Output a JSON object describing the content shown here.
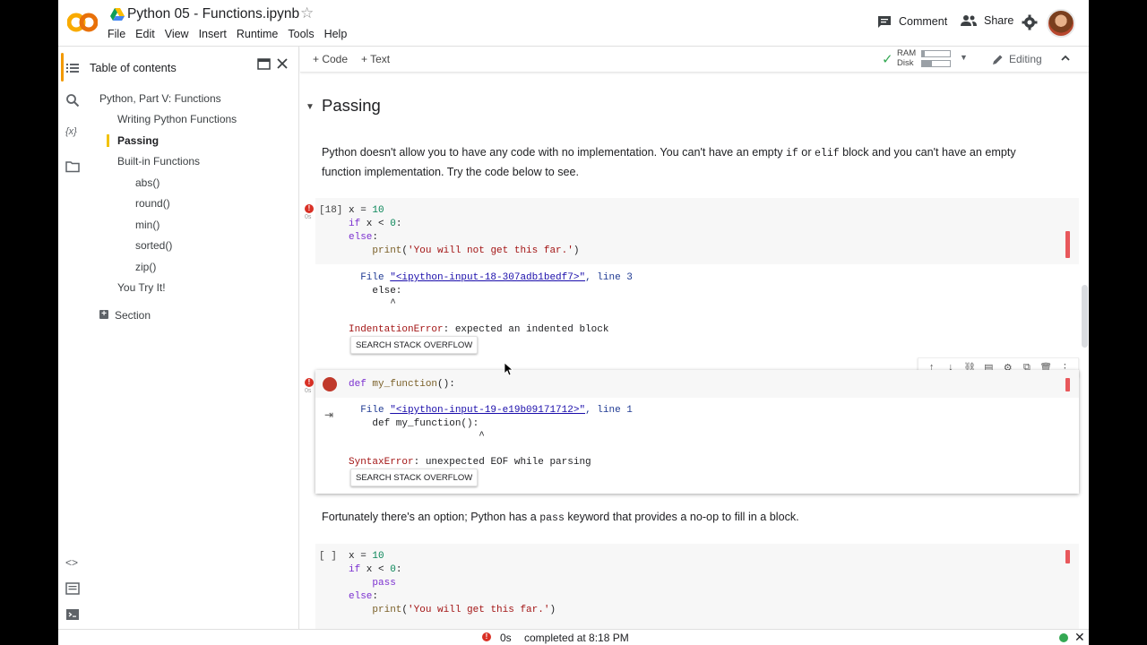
{
  "header": {
    "title": "Python 05 - Functions.ipynb",
    "menu": [
      "File",
      "Edit",
      "View",
      "Insert",
      "Runtime",
      "Tools",
      "Help"
    ],
    "comment_label": "Comment",
    "share_label": "Share"
  },
  "toc": {
    "title": "Table of contents",
    "items": [
      {
        "label": "Python, Part V: Functions",
        "level": 1
      },
      {
        "label": "Writing Python Functions",
        "level": 2
      },
      {
        "label": "Passing",
        "level": 2,
        "current": true
      },
      {
        "label": "Built-in Functions",
        "level": 2
      },
      {
        "label": "abs()",
        "level": 3
      },
      {
        "label": "round()",
        "level": 3
      },
      {
        "label": "min()",
        "level": 3
      },
      {
        "label": "sorted()",
        "level": 3
      },
      {
        "label": "zip()",
        "level": 3
      },
      {
        "label": "You Try It!",
        "level": 2
      }
    ],
    "section_label": "Section"
  },
  "toolbar": {
    "add_code": "+ Code",
    "add_text": "+ Text",
    "ram_label": "RAM",
    "disk_label": "Disk",
    "ram_fraction": 0.1,
    "disk_fraction": 0.35,
    "editing_label": "Editing"
  },
  "notebook": {
    "section_heading": "Passing",
    "intro_before_if": "Python doesn't allow you to have any code with no implementation. You can't have an empty ",
    "intro_code_if": "if",
    "intro_between": " or ",
    "intro_code_elif": "elif",
    "intro_after": " block and you can't have an empty function implementation. Try the code below to see.",
    "cell1": {
      "exec_count": "[18]",
      "time": "0s",
      "output_file_prefix": "  File ",
      "output_file_link": "\"<ipython-input-18-307adb1bedf7>\"",
      "output_file_suffix": ", line 3",
      "output_line2": "    else:",
      "output_line3": "       ^",
      "error_type": "IndentationError",
      "error_msg": ": expected an indented block",
      "so_button": "SEARCH STACK OVERFLOW"
    },
    "cell2": {
      "time": "0s",
      "output_file_prefix": "  File ",
      "output_file_link": "\"<ipython-input-19-e19b09171712>\"",
      "output_file_suffix": ", line 1",
      "output_line2": "    def my_function():",
      "output_line3": "                      ^",
      "error_type": "SyntaxError",
      "error_msg": ": unexpected EOF while parsing",
      "so_button": "SEARCH STACK OVERFLOW"
    },
    "pass_before": "Fortunately there's an option; Python has a ",
    "pass_code": "pass",
    "pass_after": " keyword that provides a no-op to fill in a block.",
    "cell3": {
      "exec_count": "[ ]"
    }
  },
  "status": {
    "time": "0s",
    "message": "completed at 8:18 PM"
  },
  "colors": {
    "accent": "#f29900",
    "error": "#d93025",
    "ok": "#34a853"
  }
}
